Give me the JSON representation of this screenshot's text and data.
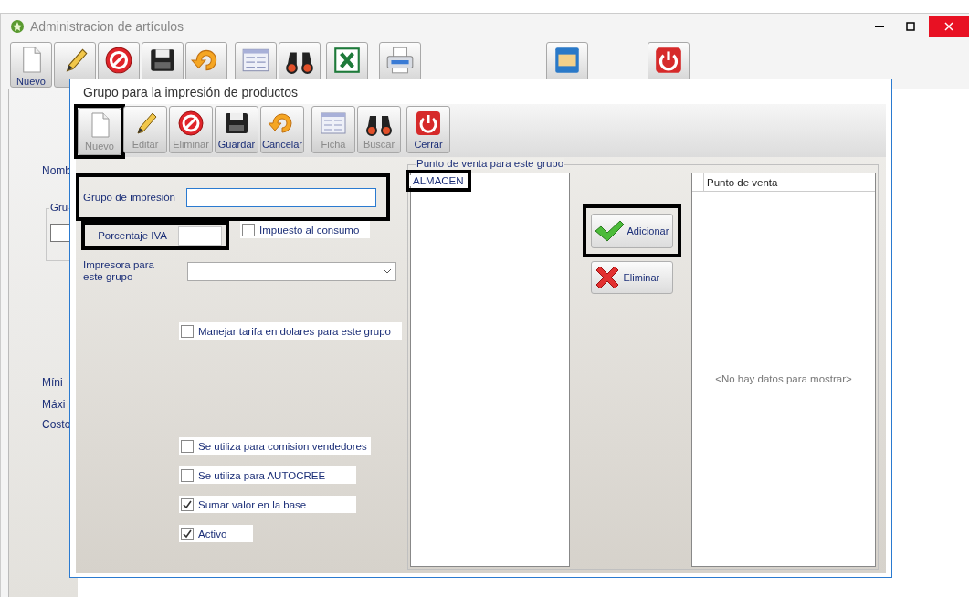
{
  "window": {
    "title": "Administracion de artículos"
  },
  "toolbar": {
    "groups": [
      [
        {
          "kind": "document",
          "label": "Nuevo"
        },
        {
          "kind": "pencil"
        },
        {
          "kind": "cancel"
        },
        {
          "kind": "floppy"
        },
        {
          "kind": "undo"
        }
      ],
      [
        {
          "kind": "form"
        },
        {
          "kind": "binoculars"
        }
      ],
      [
        {
          "kind": "excel"
        }
      ],
      [
        {
          "kind": "printer"
        }
      ],
      [
        {
          "kind": "folder"
        }
      ],
      [
        {
          "kind": "power"
        }
      ]
    ]
  },
  "background_form": {
    "labels": [
      "Nomb",
      "Míni",
      "Máxi",
      "Costo"
    ],
    "group_legend": "Gru"
  },
  "dialog": {
    "title": "Grupo para la impresión de productos",
    "toolbar": {
      "groups": [
        [
          {
            "kind": "document",
            "label": "Nuevo",
            "disabled": true,
            "highlighted": true
          },
          {
            "kind": "pencil",
            "label": "Editar",
            "disabled": true,
            "highlighted": false
          },
          {
            "kind": "cancel",
            "label": "Eliminar",
            "disabled": true,
            "highlighted": false
          },
          {
            "kind": "floppy",
            "label": "Guardar",
            "disabled": false,
            "highlighted": false
          },
          {
            "kind": "undo",
            "label": "Cancelar",
            "disabled": false,
            "highlighted": false
          }
        ],
        [
          {
            "kind": "form",
            "label": "Ficha",
            "disabled": true,
            "highlighted": false
          },
          {
            "kind": "binoculars",
            "label": "Buscar",
            "disabled": true,
            "highlighted": false
          }
        ],
        [
          {
            "kind": "power",
            "label": "Cerrar",
            "disabled": false,
            "highlighted": false
          }
        ]
      ]
    },
    "group_name": {
      "label": "Grupo de impresión",
      "highlighted": true
    },
    "iva": {
      "label": "Porcentaje IVA",
      "highlighted": true
    },
    "consumption_tax": {
      "label": "Impuesto al consumo",
      "checked": false
    },
    "printer": {
      "label": "Impresora para este grupo"
    },
    "dollar_rate": {
      "label": "Manejar tarifa en dolares para este grupo",
      "checked": false
    },
    "flags": [
      {
        "label": "Se utiliza para comision vendedores",
        "checked": false
      },
      {
        "label": "Se utiliza para AUTOCREE",
        "checked": false
      },
      {
        "label": "Sumar valor en la base",
        "checked": true
      },
      {
        "label": "Activo",
        "checked": true
      }
    ],
    "points_of_sale": {
      "legend": "Punto de venta para este grupo",
      "available": [
        {
          "label": "ALMACEN",
          "highlighted": true
        }
      ],
      "buttons": [
        {
          "kind": "check",
          "label": "Adicionar",
          "highlighted": true
        },
        {
          "kind": "cross",
          "label": "Eliminar",
          "highlighted": false
        }
      ],
      "grid": {
        "columns": [
          "Punto de venta"
        ],
        "empty_text": "<No hay datos para mostrar>"
      }
    }
  }
}
